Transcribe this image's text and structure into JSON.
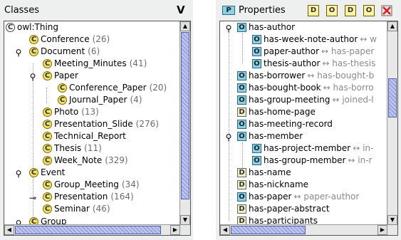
{
  "classes": {
    "title": "Classes",
    "view_button": "V",
    "icon_letter": "C",
    "items": [
      {
        "label": "owl:Thing",
        "count": ""
      },
      {
        "label": "Conference",
        "count": "(26)"
      },
      {
        "label": "Document",
        "count": "(6)"
      },
      {
        "label": "Meeting_Minutes",
        "count": "(41)"
      },
      {
        "label": "Paper",
        "count": ""
      },
      {
        "label": "Conference_Paper",
        "count": "(20)"
      },
      {
        "label": "Journal_Paper",
        "count": "(4)"
      },
      {
        "label": "Photo",
        "count": "(13)"
      },
      {
        "label": "Presentation_Slide",
        "count": "(276)"
      },
      {
        "label": "Technical_Report",
        "count": ""
      },
      {
        "label": "Thesis",
        "count": "(11)"
      },
      {
        "label": "Week_Note",
        "count": "(329)"
      },
      {
        "label": "Event",
        "count": ""
      },
      {
        "label": "Group_Meeting",
        "count": "(34)"
      },
      {
        "label": "Presentation",
        "count": "(164)"
      },
      {
        "label": "Seminar",
        "count": "(46)"
      },
      {
        "label": "Group",
        "count": ""
      }
    ]
  },
  "properties": {
    "title": "Properties",
    "title_icon": "P",
    "object_icon_letter": "O",
    "datatype_icon_letter": "D",
    "toolbar": {
      "icons": [
        "add-datatype-property-icon",
        "add-object-property-icon",
        "add-datatype-subproperty-icon",
        "add-object-subproperty-icon",
        "delete-property-icon"
      ],
      "letters": [
        "D",
        "O",
        "D",
        "O",
        "X"
      ]
    },
    "items": [
      {
        "label": "has-author",
        "rel": "",
        "type": "object"
      },
      {
        "label": "has-week-note-author",
        "rel": "↔ w",
        "type": "object"
      },
      {
        "label": "paper-author",
        "rel": "↔ has-paper",
        "type": "object"
      },
      {
        "label": "thesis-author",
        "rel": "↔ has-thesis",
        "type": "object"
      },
      {
        "label": "has-borrower",
        "rel": "↔ has-bought-b",
        "type": "object"
      },
      {
        "label": "has-bought-book",
        "rel": "↔ has-borro",
        "type": "object"
      },
      {
        "label": "has-group-meeting",
        "rel": "↔ joined-l",
        "type": "object"
      },
      {
        "label": "has-home-page",
        "rel": "",
        "type": "datatype"
      },
      {
        "label": "has-meeting-record",
        "rel": "",
        "type": "object"
      },
      {
        "label": "has-member",
        "rel": "",
        "type": "object"
      },
      {
        "label": "has-project-member",
        "rel": "↔ in-",
        "type": "object"
      },
      {
        "label": "has-group-member",
        "rel": "↔ in-r",
        "type": "object"
      },
      {
        "label": "has-name",
        "rel": "",
        "type": "datatype"
      },
      {
        "label": "has-nickname",
        "rel": "",
        "type": "datatype"
      },
      {
        "label": "has-paper",
        "rel": "↔ paper-author",
        "type": "object"
      },
      {
        "label": "has-paper-abstract",
        "rel": "",
        "type": "datatype"
      },
      {
        "label": "has-participants",
        "rel": "",
        "type": "datatype"
      }
    ]
  },
  "colors": {
    "class_icon": "#f2e26a",
    "object_property_icon": "#8fd0e0",
    "scroll_thumb": "#9aa5e0",
    "delete_icon": "#d42020"
  }
}
